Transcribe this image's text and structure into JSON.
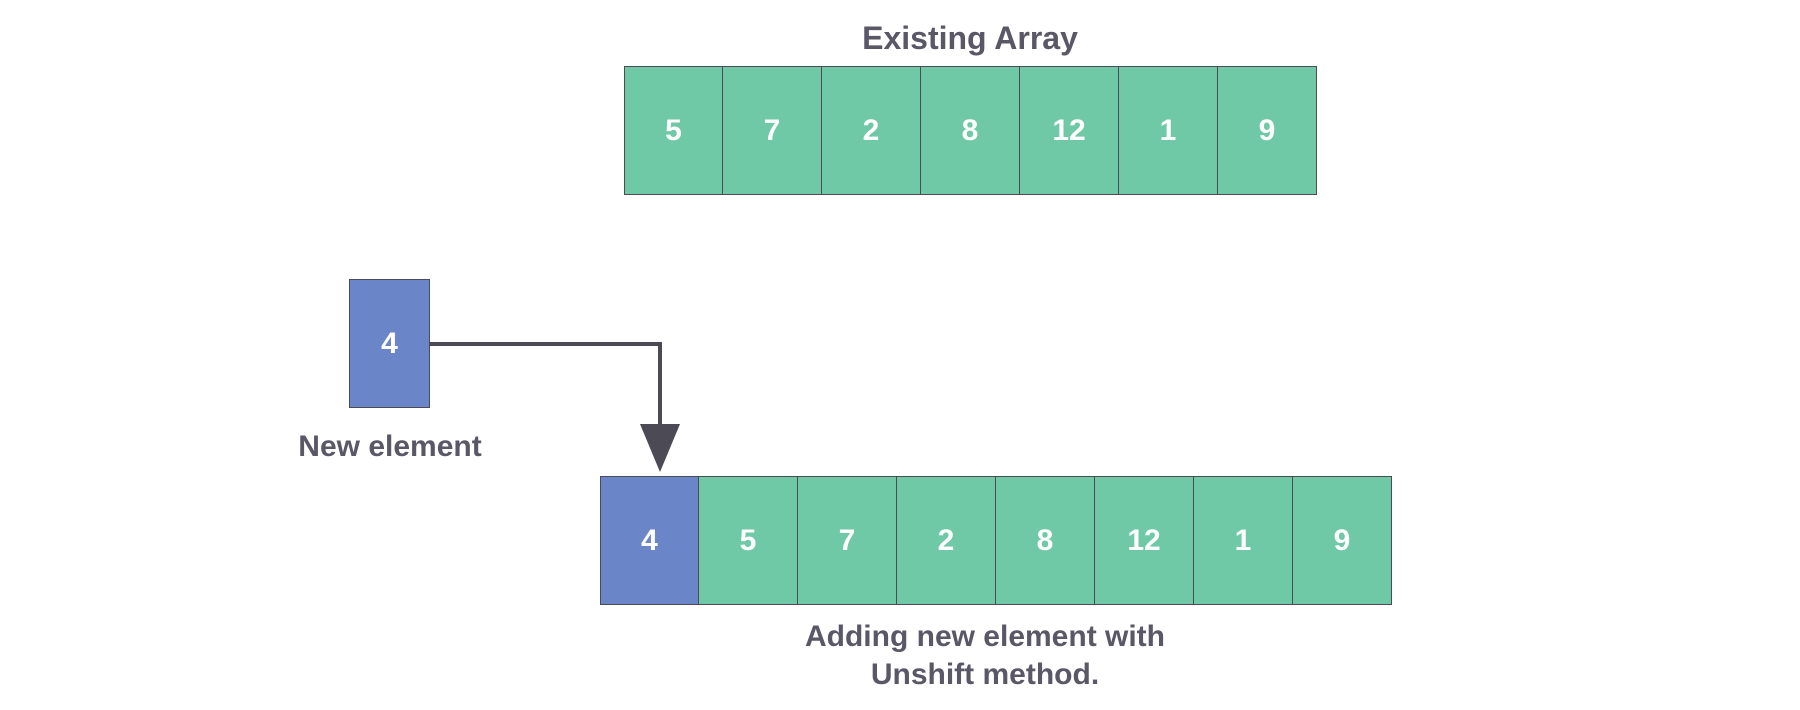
{
  "labels": {
    "existing": "Existing Array",
    "new_element": "New element",
    "result_line1": "Adding new element with",
    "result_line2": "Unshift method."
  },
  "existing_array": [
    "5",
    "7",
    "2",
    "8",
    "12",
    "1",
    "9"
  ],
  "new_element": "4",
  "result_array": [
    {
      "value": "4",
      "color": "blue"
    },
    {
      "value": "5",
      "color": "green"
    },
    {
      "value": "7",
      "color": "green"
    },
    {
      "value": "2",
      "color": "green"
    },
    {
      "value": "8",
      "color": "green"
    },
    {
      "value": "12",
      "color": "green"
    },
    {
      "value": "1",
      "color": "green"
    },
    {
      "value": "9",
      "color": "green"
    }
  ],
  "colors": {
    "green": "#6fc9a6",
    "blue": "#6a86c8",
    "text": "#5a5766",
    "border": "#4b4a55"
  }
}
